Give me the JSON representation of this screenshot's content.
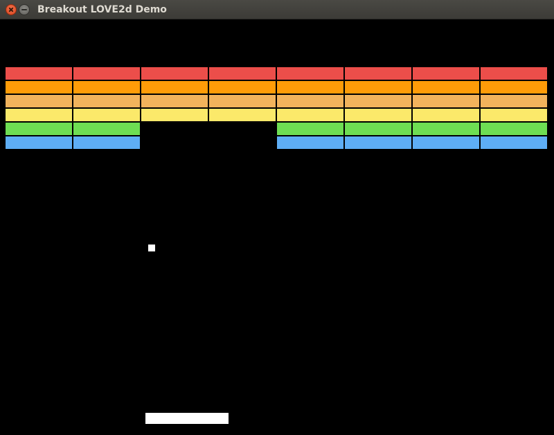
{
  "window": {
    "title": "Breakout LOVE2d Demo",
    "controls": {
      "close_icon": "close-icon",
      "minimize_icon": "minimize-icon"
    }
  },
  "game": {
    "brick_columns": 8,
    "brick_rows": 6,
    "rows": [
      {
        "color": "#ec4e4a",
        "present": [
          true,
          true,
          true,
          true,
          true,
          true,
          true,
          true
        ]
      },
      {
        "color": "#ff9c08",
        "present": [
          true,
          true,
          true,
          true,
          true,
          true,
          true,
          true
        ]
      },
      {
        "color": "#f2b35c",
        "present": [
          true,
          true,
          true,
          true,
          true,
          true,
          true,
          true
        ]
      },
      {
        "color": "#fbe96a",
        "present": [
          true,
          true,
          true,
          true,
          true,
          true,
          true,
          true
        ]
      },
      {
        "color": "#6ede53",
        "present": [
          true,
          true,
          false,
          false,
          true,
          true,
          true,
          true
        ]
      },
      {
        "color": "#5eaef5",
        "present": [
          true,
          true,
          false,
          false,
          true,
          true,
          true,
          true
        ]
      }
    ],
    "ball_color": "#ffffff",
    "paddle_color": "#ffffff"
  }
}
